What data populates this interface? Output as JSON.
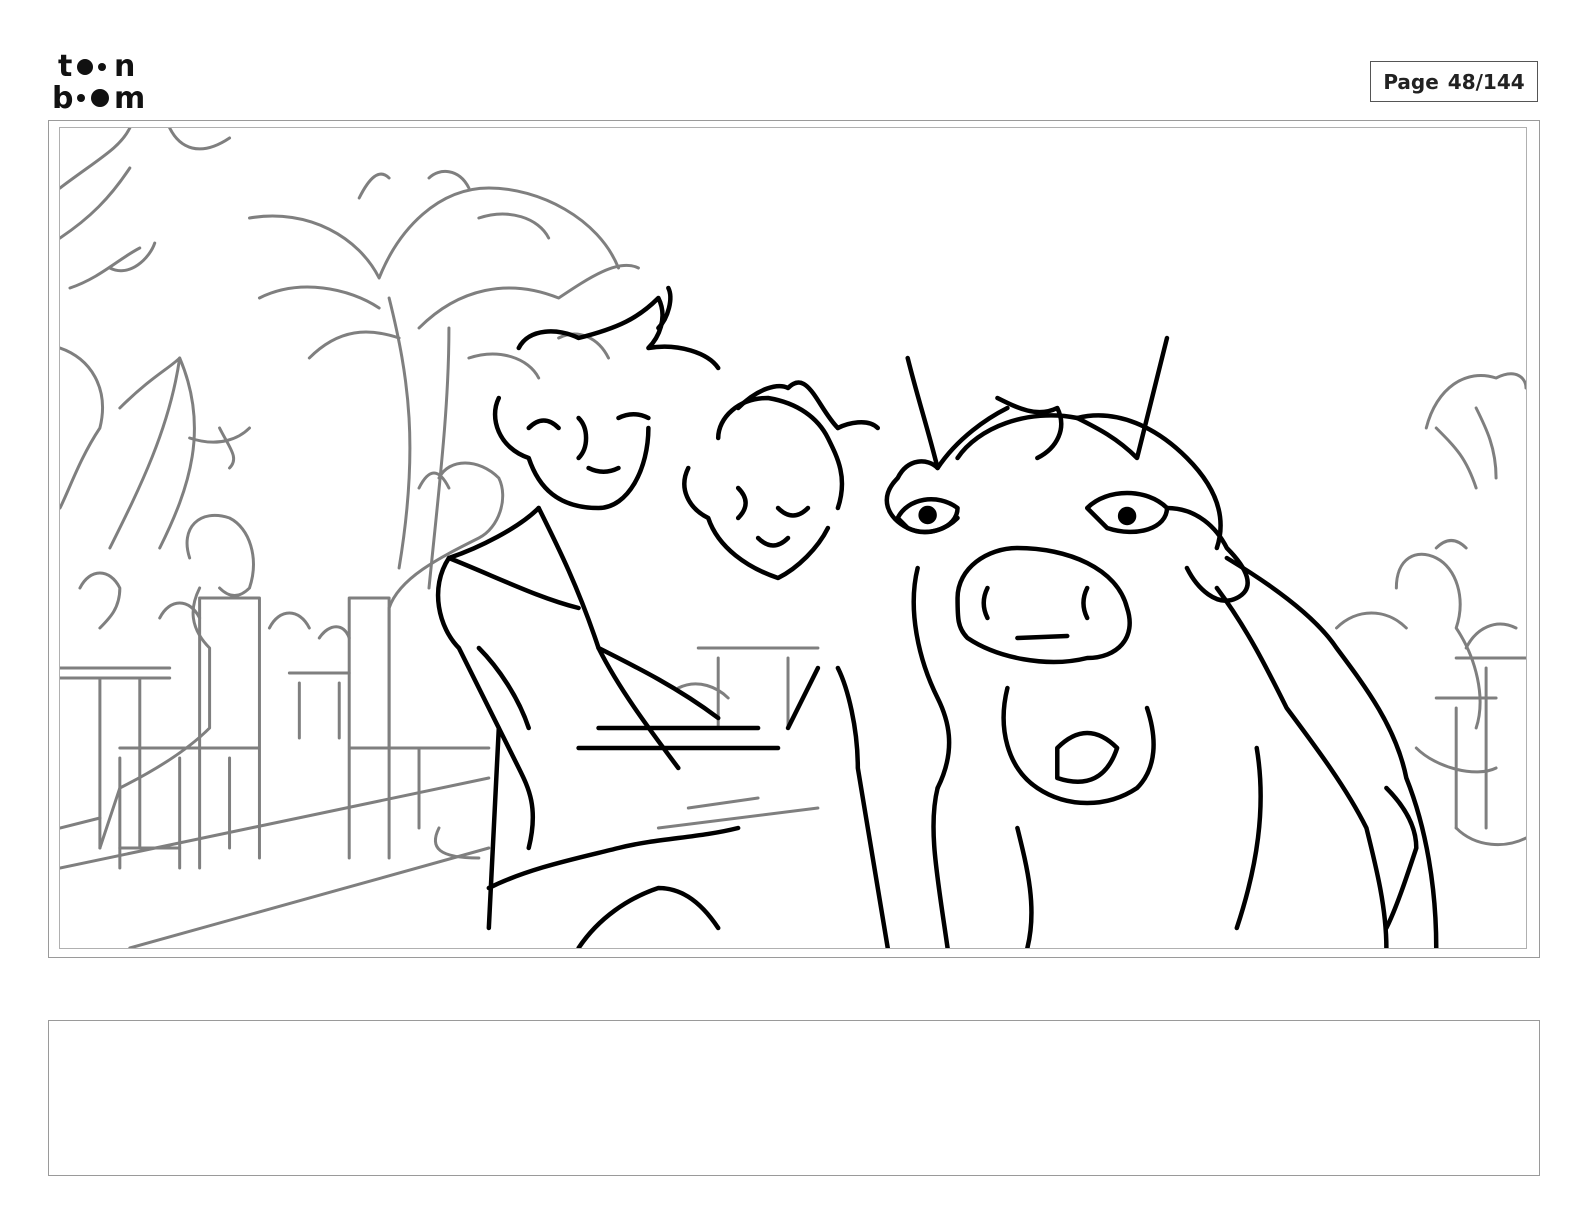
{
  "header": {
    "logo_line1": "toon",
    "logo_line2": "boom",
    "page_label": "Page 48/144"
  },
  "notes": {
    "text": ""
  }
}
